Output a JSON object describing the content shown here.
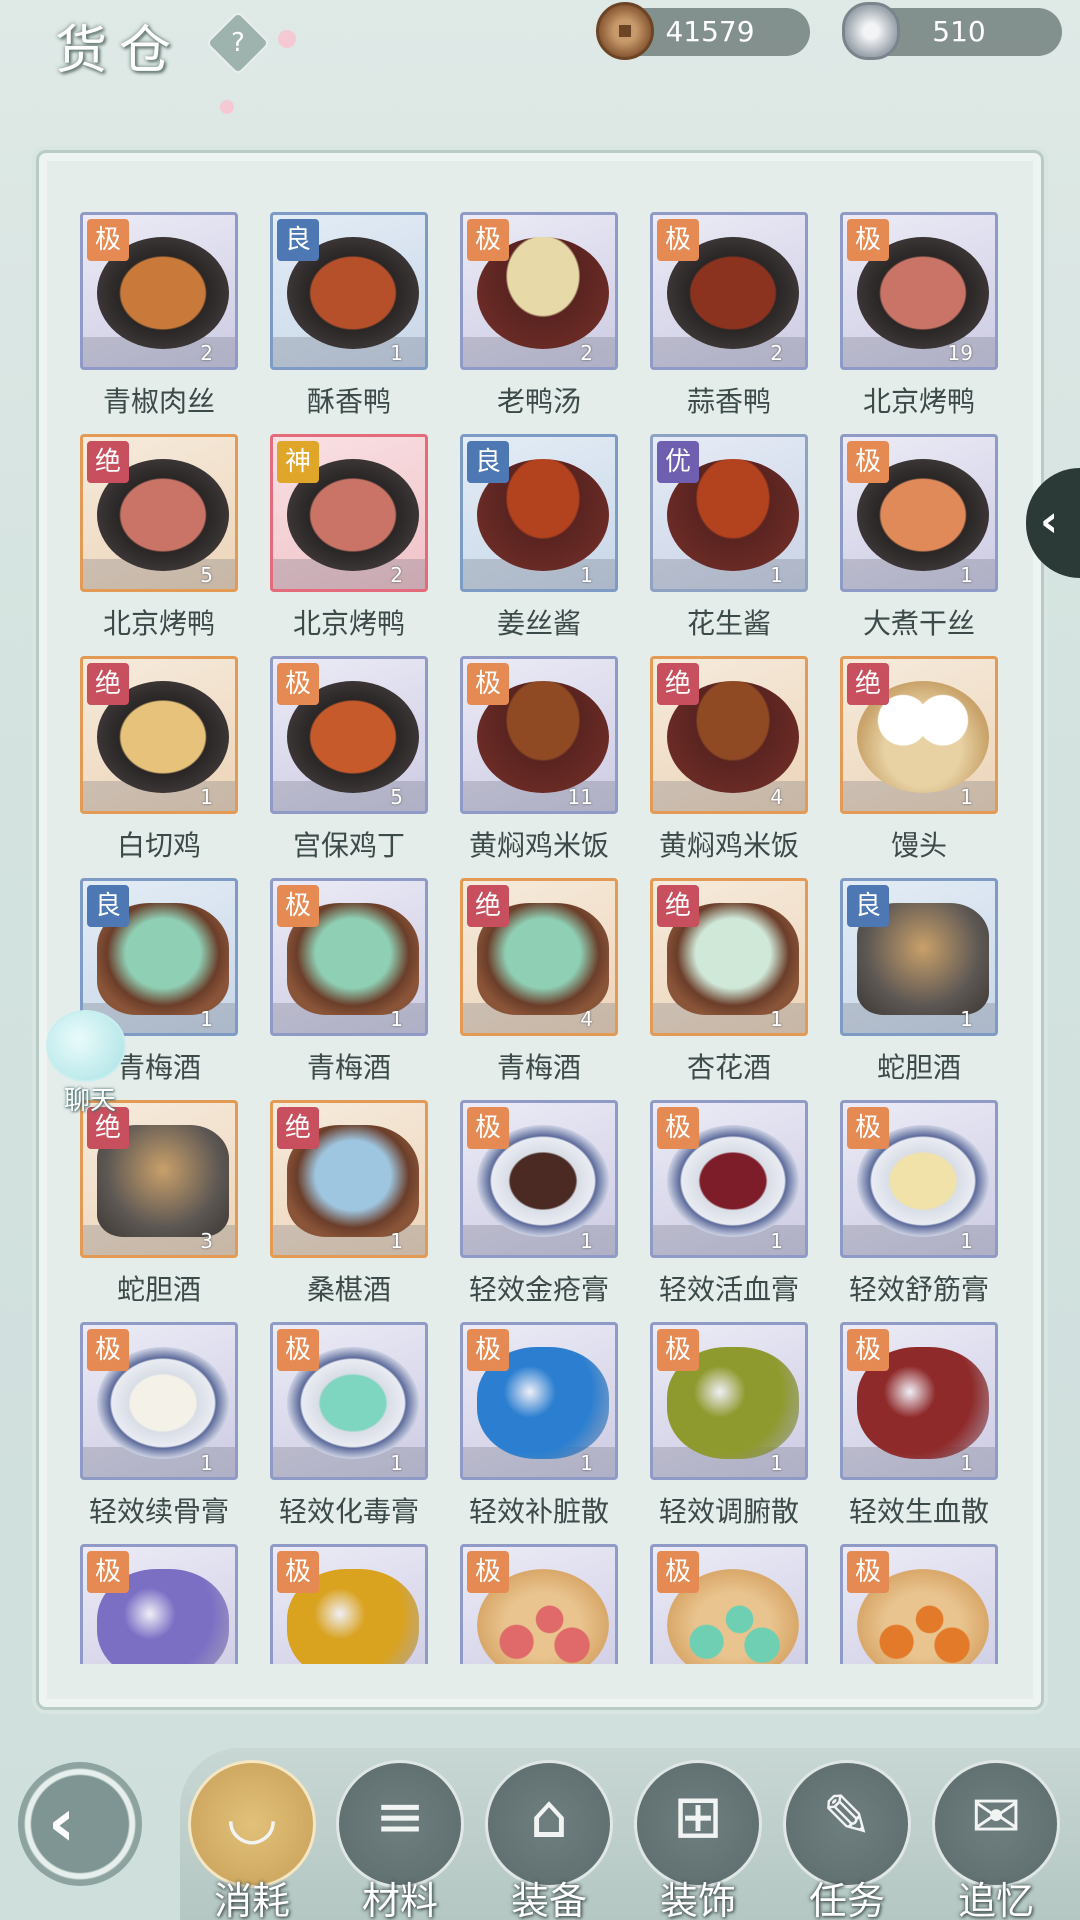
{
  "header": {
    "title": "货仓",
    "help_label": "?",
    "currencies": [
      {
        "name": "copper-coin",
        "value": "41579"
      },
      {
        "name": "silver-ingot",
        "value": "510"
      }
    ]
  },
  "side_arrow": "‹",
  "chat": {
    "label": "聊天"
  },
  "items": [
    {
      "name": "青椒肉丝",
      "grade": "极",
      "tier": "ji",
      "count": "2",
      "shape": "plate",
      "color": "#c97a3a"
    },
    {
      "name": "酥香鸭",
      "grade": "良",
      "tier": "liang",
      "count": "1",
      "shape": "plate",
      "color": "#b5502a"
    },
    {
      "name": "老鸭汤",
      "grade": "极",
      "tier": "ji",
      "count": "2",
      "shape": "bowl",
      "color": "#e7d9a8"
    },
    {
      "name": "蒜香鸭",
      "grade": "极",
      "tier": "ji",
      "count": "2",
      "shape": "plate",
      "color": "#8c3320"
    },
    {
      "name": "北京烤鸭",
      "grade": "极",
      "tier": "ji",
      "count": "19",
      "shape": "plate",
      "color": "#c97466"
    },
    {
      "name": "北京烤鸭",
      "grade": "绝",
      "tier": "jue",
      "count": "5",
      "shape": "plate",
      "color": "#c97466"
    },
    {
      "name": "北京烤鸭",
      "grade": "神",
      "tier": "shen",
      "count": "2",
      "shape": "plate",
      "color": "#c97466"
    },
    {
      "name": "姜丝酱",
      "grade": "良",
      "tier": "liang",
      "count": "1",
      "shape": "bowl",
      "color": "#b3421f"
    },
    {
      "name": "花生酱",
      "grade": "优",
      "tier": "you",
      "count": "1",
      "shape": "bowl",
      "color": "#b3421f"
    },
    {
      "name": "大煮干丝",
      "grade": "极",
      "tier": "ji",
      "count": "1",
      "shape": "plate",
      "color": "#e08a5a"
    },
    {
      "name": "白切鸡",
      "grade": "绝",
      "tier": "jue",
      "count": "1",
      "shape": "plate",
      "color": "#e6c27a"
    },
    {
      "name": "宫保鸡丁",
      "grade": "极",
      "tier": "ji",
      "count": "5",
      "shape": "plate",
      "color": "#c65a2a"
    },
    {
      "name": "黄焖鸡米饭",
      "grade": "极",
      "tier": "ji",
      "count": "11",
      "shape": "bowl",
      "color": "#8f4a24"
    },
    {
      "name": "黄焖鸡米饭",
      "grade": "绝",
      "tier": "jue",
      "count": "4",
      "shape": "bowl",
      "color": "#8f4a24"
    },
    {
      "name": "馒头",
      "grade": "绝",
      "tier": "jue",
      "count": "1",
      "shape": "buns",
      "color": "#ffffff"
    },
    {
      "name": "青梅酒",
      "grade": "良",
      "tier": "liang",
      "count": "1",
      "shape": "pitcher",
      "color": "#8fcfb4"
    },
    {
      "name": "青梅酒",
      "grade": "极",
      "tier": "ji",
      "count": "1",
      "shape": "pitcher",
      "color": "#8fcfb4"
    },
    {
      "name": "青梅酒",
      "grade": "绝",
      "tier": "jue",
      "count": "4",
      "shape": "pitcher",
      "color": "#8fcfb4"
    },
    {
      "name": "杏花酒",
      "grade": "绝",
      "tier": "jue",
      "count": "1",
      "shape": "pitcher",
      "color": "#cfe8d8"
    },
    {
      "name": "蛇胆酒",
      "grade": "良",
      "tier": "liang",
      "count": "1",
      "shape": "jar",
      "color": "#c9a06a"
    },
    {
      "name": "蛇胆酒",
      "grade": "绝",
      "tier": "jue",
      "count": "3",
      "shape": "jar",
      "color": "#c9a06a"
    },
    {
      "name": "桑椹酒",
      "grade": "绝",
      "tier": "jue",
      "count": "1",
      "shape": "pitcher",
      "color": "#9fc6e0"
    },
    {
      "name": "轻效金疮膏",
      "grade": "极",
      "tier": "ji",
      "count": "1",
      "shape": "pot",
      "color": "#4a2a22"
    },
    {
      "name": "轻效活血膏",
      "grade": "极",
      "tier": "ji",
      "count": "1",
      "shape": "pot",
      "color": "#7d1d2a"
    },
    {
      "name": "轻效舒筋膏",
      "grade": "极",
      "tier": "ji",
      "count": "1",
      "shape": "pot",
      "color": "#f0e2a8"
    },
    {
      "name": "轻效续骨膏",
      "grade": "极",
      "tier": "ji",
      "count": "1",
      "shape": "pot",
      "color": "#f4f1e8"
    },
    {
      "name": "轻效化毒膏",
      "grade": "极",
      "tier": "ji",
      "count": "1",
      "shape": "pot",
      "color": "#7fd6c0"
    },
    {
      "name": "轻效补脏散",
      "grade": "极",
      "tier": "ji",
      "count": "1",
      "shape": "powder",
      "color": "#2c7fd0"
    },
    {
      "name": "轻效调腑散",
      "grade": "极",
      "tier": "ji",
      "count": "1",
      "shape": "powder",
      "color": "#8f9a2e"
    },
    {
      "name": "轻效生血散",
      "grade": "极",
      "tier": "ji",
      "count": "1",
      "shape": "powder",
      "color": "#8f2a2a"
    },
    {
      "name": "",
      "grade": "极",
      "tier": "ji",
      "count": "",
      "shape": "powder",
      "color": "#7b6fc4"
    },
    {
      "name": "",
      "grade": "极",
      "tier": "ji",
      "count": "",
      "shape": "powder",
      "color": "#d9a21f"
    },
    {
      "name": "",
      "grade": "极",
      "tier": "ji",
      "count": "",
      "shape": "pills",
      "color": "#e06a6a"
    },
    {
      "name": "",
      "grade": "极",
      "tier": "ji",
      "count": "",
      "shape": "pills",
      "color": "#6fcfb2"
    },
    {
      "name": "",
      "grade": "极",
      "tier": "ji",
      "count": "",
      "shape": "pills",
      "color": "#e37a2a"
    }
  ],
  "back_button": "‹",
  "tabs": [
    {
      "id": "consume",
      "label": "消耗",
      "icon": "bowl-icon",
      "glyph": "◡",
      "active": true
    },
    {
      "id": "material",
      "label": "材料",
      "icon": "logs-icon",
      "glyph": "≡",
      "active": false
    },
    {
      "id": "equip",
      "label": "装备",
      "icon": "robe-icon",
      "glyph": "⌂",
      "active": false
    },
    {
      "id": "decor",
      "label": "装饰",
      "icon": "fence-icon",
      "glyph": "⊞",
      "active": false
    },
    {
      "id": "task",
      "label": "任务",
      "icon": "scroll-icon",
      "glyph": "✎",
      "active": false
    },
    {
      "id": "memory",
      "label": "追忆",
      "icon": "letter-icon",
      "glyph": "✉",
      "active": false
    }
  ]
}
